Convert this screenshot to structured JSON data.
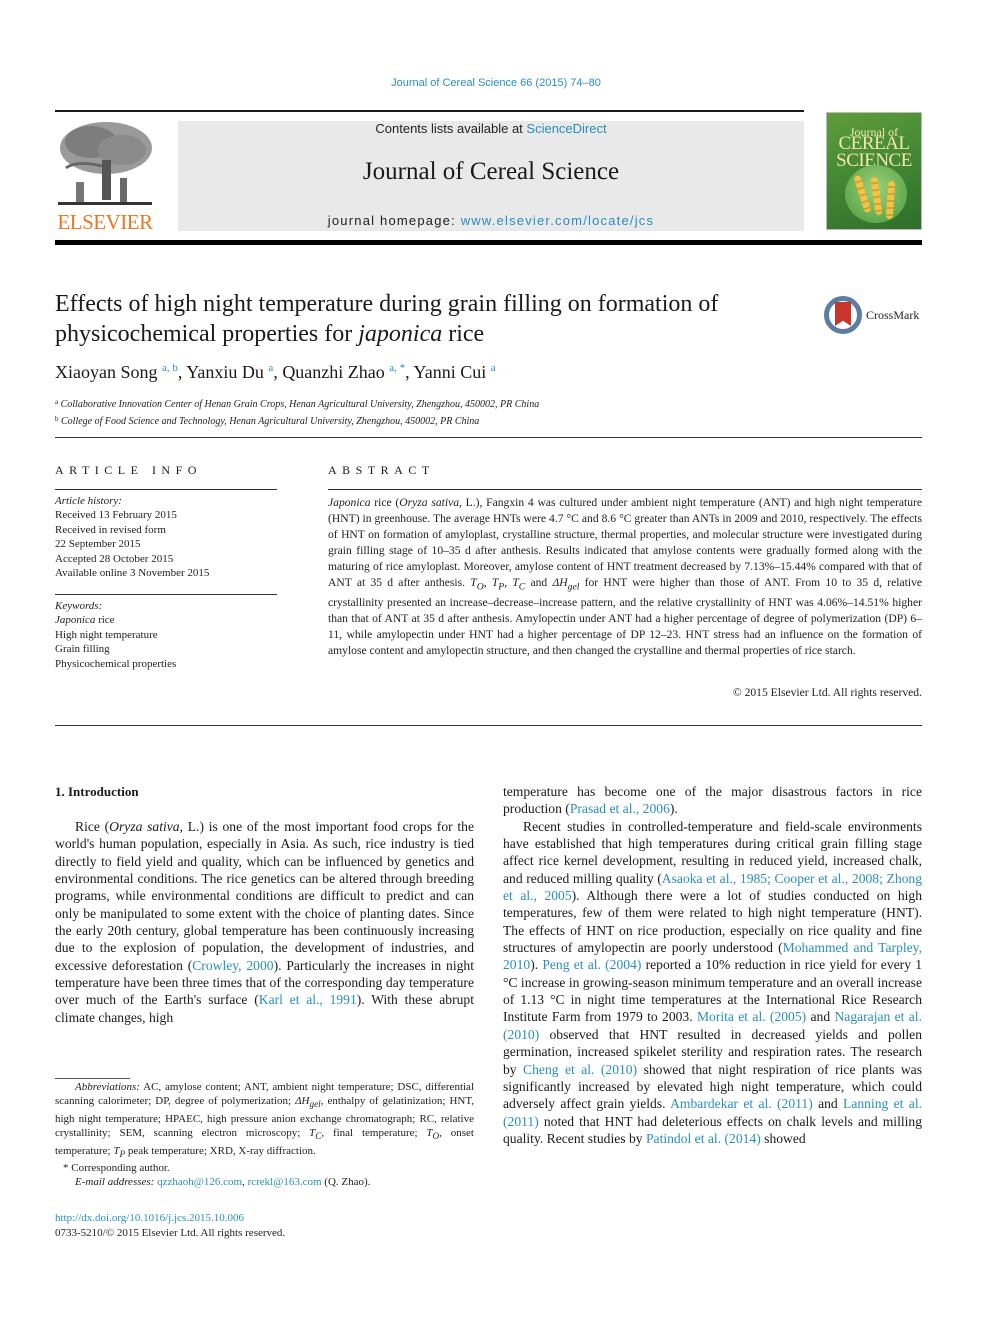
{
  "running_head": "Journal of Cereal Science 66 (2015) 74–80",
  "masthead": {
    "contents_prefix": "Contents lists available at ",
    "contents_link": "ScienceDirect",
    "journal_title": "Journal of Cereal Science",
    "homepage_prefix": "journal homepage: ",
    "homepage_link": "www.elsevier.com/locate/jcs",
    "publisher_logo": "ELSEVIER",
    "cover_line1": "Journal of",
    "cover_line2": "CEREAL",
    "cover_line3": "SCIENCE"
  },
  "article": {
    "title_part1": "Effects of high night temperature during grain filling on formation of physicochemical properties for ",
    "title_italic": "japonica",
    "title_part2": " rice",
    "crossmark_label": "CrossMark",
    "authors": [
      {
        "name": "Xiaoyan Song",
        "sup": "a, b",
        "sep": ", "
      },
      {
        "name": "Yanxiu Du",
        "sup": "a",
        "sep": ", "
      },
      {
        "name": "Quanzhi Zhao",
        "sup": "a, *",
        "sep": ", "
      },
      {
        "name": "Yanni Cui",
        "sup": "a",
        "sep": ""
      }
    ],
    "affiliations": [
      {
        "mark": "a",
        "text": "Collaborative Innovation Center of Henan Grain Crops, Henan Agricultural University, Zhengzhou, 450002, PR China"
      },
      {
        "mark": "b",
        "text": "College of Food Science and Technology, Henan Agricultural University, Zhengzhou, 450002, PR China"
      }
    ]
  },
  "article_info": {
    "heading": "ARTICLE INFO",
    "history_label": "Article history:",
    "history": [
      "Received 13 February 2015",
      "Received in revised form",
      "22 September 2015",
      "Accepted 28 October 2015",
      "Available online 3 November 2015"
    ],
    "keywords_label": "Keywords:",
    "keyword1_italic": "Japonica",
    "keyword1_rest": " rice",
    "keywords": [
      "High night temperature",
      "Grain filling",
      "Physicochemical properties"
    ]
  },
  "abstract": {
    "heading": "ABSTRACT",
    "s1_it": "Japonica",
    "s1a": " rice (",
    "s1_it2": "Oryza sativa",
    "s1b": ", L.), Fangxin 4 was cultured under ambient night temperature (ANT) and high night temperature (HNT) in greenhouse. The average HNTs were 4.7 °C and 8.6 °C greater than ANTs in 2009 and 2010, respectively. The effects of HNT on formation of amyloplast, crystalline structure, thermal properties, and molecular structure were investigated during grain filling stage of 10–35 d after anthesis. Results indicated that amylose contents were gradually formed along with the maturing of rice amyloplast. Moreover, amylose content of HNT treatment decreased by 7.13%–15.44% compared with that of ANT at 35 d after anthesis. ",
    "to": "T",
    "to_sub": "O",
    "tp": "T",
    "tp_sub": "P",
    "tc": "T",
    "tc_sub": "C",
    "dh": "ΔH",
    "dh_sub": "gel",
    "s2": " for HNT were higher than those of ANT. From 10 to 35 d, relative crystallinity presented an increase–decrease–increase pattern, and the relative crystallinity of HNT was 4.06%–14.51% higher than that of ANT at 35 d after anthesis. Amylopectin under ANT had a higher percentage of degree of polymerization (DP) 6–11, while amylopectin under HNT had a higher percentage of DP 12–23. HNT stress had an influence on the formation of amylose content and amylopectin structure, and then changed the crystalline and thermal properties of rice starch.",
    "copyright": "© 2015 Elsevier Ltd. All rights reserved."
  },
  "introduction": {
    "heading": "1.  Introduction",
    "left_p1_a": "Rice (",
    "left_p1_it": "Oryza sativa",
    "left_p1_b": ", L.) is one of the most important food crops for the world's human population, especially in Asia. As such, rice industry is tied directly to field yield and quality, which can be influenced by genetics and environmental conditions. The rice genetics can be altered through breeding programs, while environmental conditions are difficult to predict and can only be manipulated to some extent with the choice of planting dates. Since the early 20th century, global temperature has been continuously increasing due to the explosion of population, the development of industries, and excessive deforestation (",
    "cite_crowley": "Crowley, 2000",
    "left_p1_c": "). Particularly the increases in night temperature have been three times that of the corresponding day temperature over much of the Earth's surface (",
    "cite_karl": "Karl et al., 1991",
    "left_p1_d": "). With these abrupt climate changes, high",
    "right_p0_a": "temperature has become one of the major disastrous factors in rice production (",
    "cite_prasad": "Prasad et al., 2006",
    "right_p0_b": ").",
    "right_p1_a": "Recent studies in controlled-temperature and field-scale environments have established that high temperatures during critical grain filling stage affect rice kernel development, resulting in reduced yield, increased chalk, and reduced milling quality (",
    "cite_asaoka": "Asaoka et al., 1985; Cooper et al., 2008; Zhong et al., 2005",
    "right_p1_b": "). Although there were a lot of studies conducted on high temperatures, few of them were related to high night temperature (HNT). The effects of HNT on rice production, especially on rice quality and fine structures of amylopectin are poorly understood (",
    "cite_mohammed": "Mohammed and Tarpley, 2010",
    "right_p1_c": "). ",
    "cite_peng": "Peng et al. (2004)",
    "right_p1_d": " reported a 10% reduction in rice yield for every 1 °C increase in growing-season minimum temperature and an overall increase of 1.13 °C in night time temperatures at the International Rice Research Institute Farm from 1979 to 2003. ",
    "cite_morita": "Morita et al. (2005)",
    "right_p1_e": " and ",
    "cite_nagarajan": "Nagarajan et al. (2010)",
    "right_p1_f": " observed that HNT resulted in decreased yields and pollen germination, increased spikelet sterility and respiration rates. The research by ",
    "cite_cheng": "Cheng et al. (2010)",
    "right_p1_g": " showed that night respiration of rice plants was significantly increased by elevated high night temperature, which could adversely affect grain yields. ",
    "cite_ambardekar": "Ambardekar et al. (2011)",
    "right_p1_h": " and ",
    "cite_lanning": "Lanning et al. (2011)",
    "right_p1_i": " noted that HNT had deleterious effects on chalk levels and milling quality. Recent studies by ",
    "cite_patindol": "Patindol et al. (2014)",
    "right_p1_j": " showed"
  },
  "footnotes": {
    "abbrev_label": "Abbreviations:",
    "abbrev_a": " AC, amylose content; ANT, ambient night temperature; DSC, differential scanning calorimeter; DP, degree of polymerization; ",
    "abbrev_dh": "ΔH",
    "abbrev_dh_sub": "gel",
    "abbrev_b": ", enthalpy of gelatinization; HNT, high night temperature; HPAEC, high pressure anion exchange chromatograph; RC, relative crystallinity; SEM, scanning electron microscopy; ",
    "abbrev_tc": "T",
    "abbrev_tc_sub": "C",
    "abbrev_c": ", final temperature; ",
    "abbrev_to": "T",
    "abbrev_to_sub": "O",
    "abbrev_d": ", onset temperature; ",
    "abbrev_tp": "T",
    "abbrev_tp_sub": "P",
    "abbrev_e": " peak temperature; XRD, X-ray diffraction.",
    "corresponding": "* Corresponding author.",
    "email_label": "E-mail addresses:",
    "email1": "qzzhaoh@126.com",
    "email_sep": ", ",
    "email2": "rcrekl@163.com",
    "email_suffix": " (Q. Zhao).",
    "doi": "http://dx.doi.org/10.1016/j.jcs.2015.10.006",
    "issn": "0733-5210/© 2015 Elsevier Ltd. All rights reserved."
  }
}
